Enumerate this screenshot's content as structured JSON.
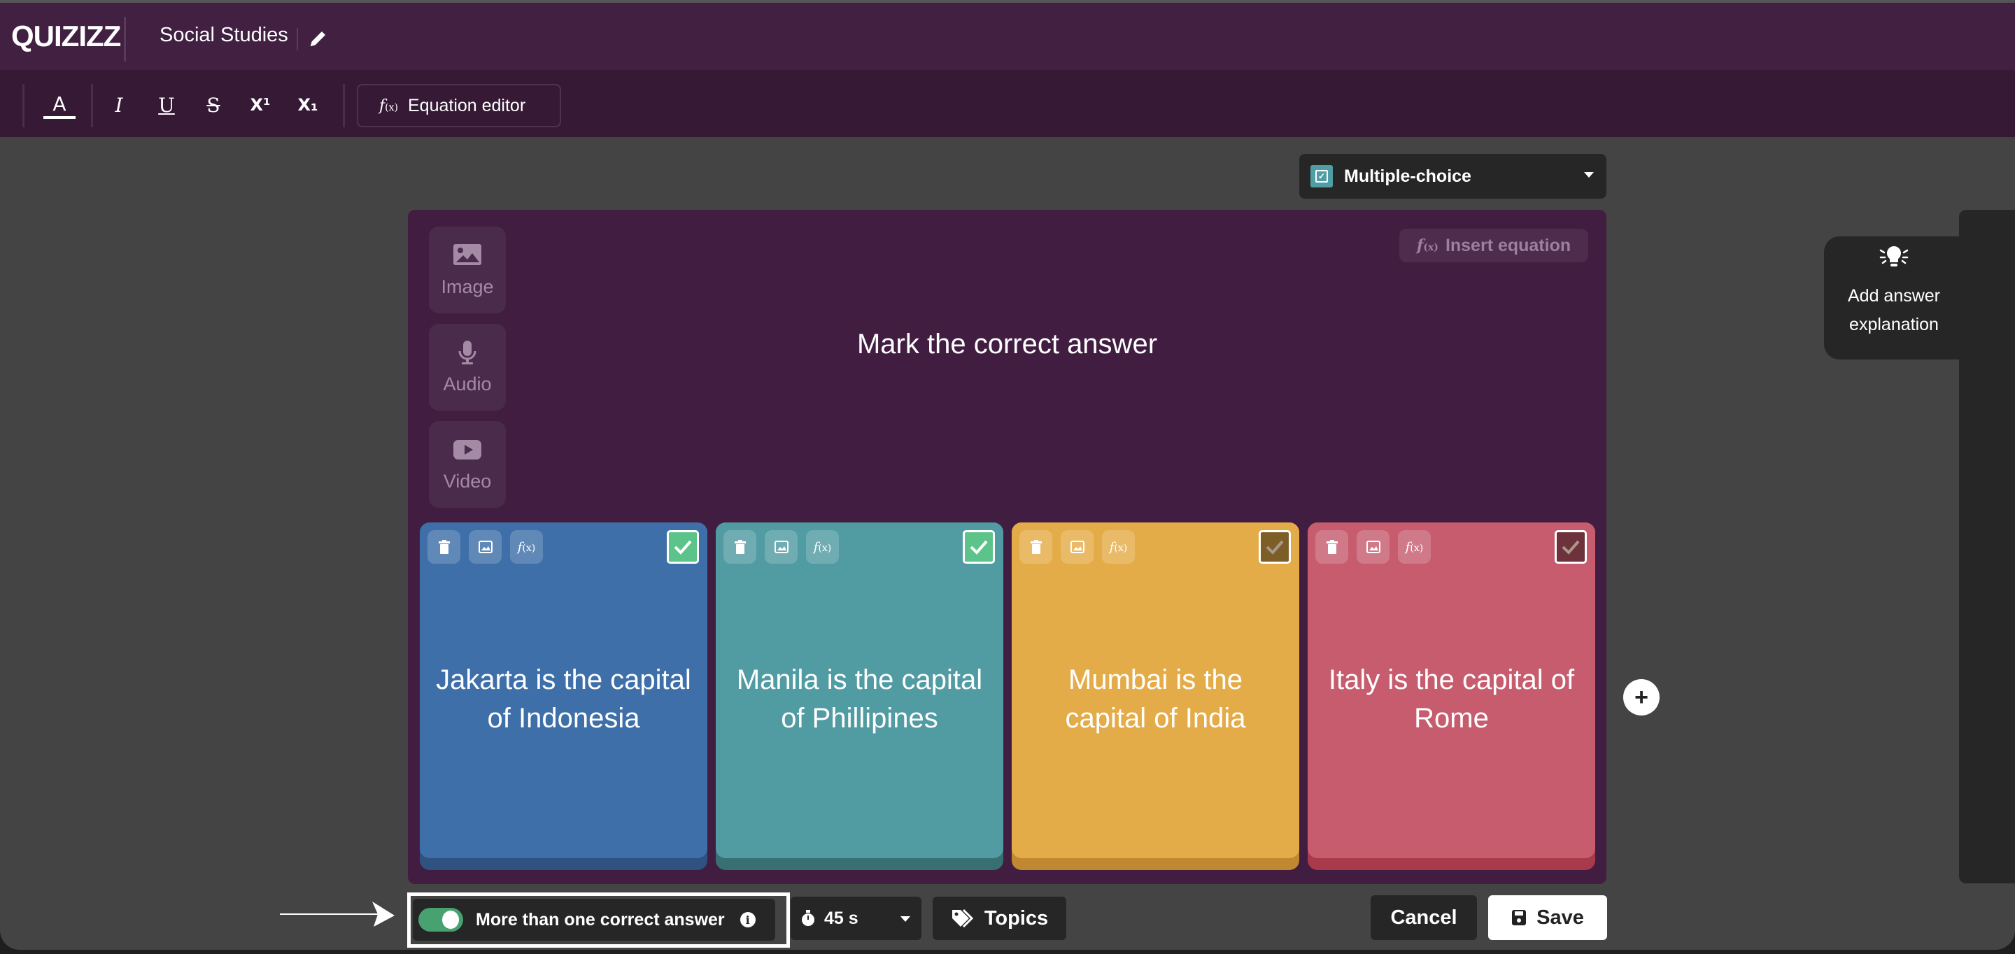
{
  "header": {
    "logo": "QUIZIZZ",
    "title": "Social Studies",
    "edit_icon": "pencil-icon"
  },
  "toolbar": {
    "buttons": [
      {
        "name": "text-color",
        "label": "A"
      },
      {
        "name": "italic",
        "label": "I"
      },
      {
        "name": "underline",
        "label": "U"
      },
      {
        "name": "strikethrough",
        "label": "S"
      },
      {
        "name": "superscript",
        "label": "X¹"
      },
      {
        "name": "subscript",
        "label": "X₁"
      }
    ],
    "equation_editor": "Equation editor",
    "fx_icon": "f(x)"
  },
  "question_type": {
    "selected": "Multiple-choice",
    "accent": "#4f9ea6"
  },
  "question": {
    "media": [
      {
        "label": "Image",
        "icon": "image-icon"
      },
      {
        "label": "Audio",
        "icon": "microphone-icon"
      },
      {
        "label": "Video",
        "icon": "video-icon"
      }
    ],
    "insert_equation": "Insert equation",
    "text": "Mark the correct answer"
  },
  "answers": [
    {
      "text": "Jakarta is the capital of Indonesia",
      "color": "#3f6fa8",
      "shade": "#2f5280",
      "correct": true
    },
    {
      "text": "Manila is the capital of Phillipines",
      "color": "#519ba3",
      "shade": "#386f72",
      "correct": true
    },
    {
      "text": "Mumbai is the capital of India",
      "color": "#e4ac48",
      "shade": "#c08830",
      "correct": false
    },
    {
      "text": "Italy is the capital of Rome",
      "color": "#c65c6e",
      "shade": "#a83a4c",
      "correct": false
    }
  ],
  "explanation": {
    "label_line1": "Add answer",
    "label_line2": "explanation"
  },
  "footer": {
    "multiple_correct_label": "More than one correct answer",
    "multiple_correct_enabled": true,
    "timer": "45 s",
    "topics": "Topics",
    "cancel": "Cancel",
    "save": "Save"
  }
}
